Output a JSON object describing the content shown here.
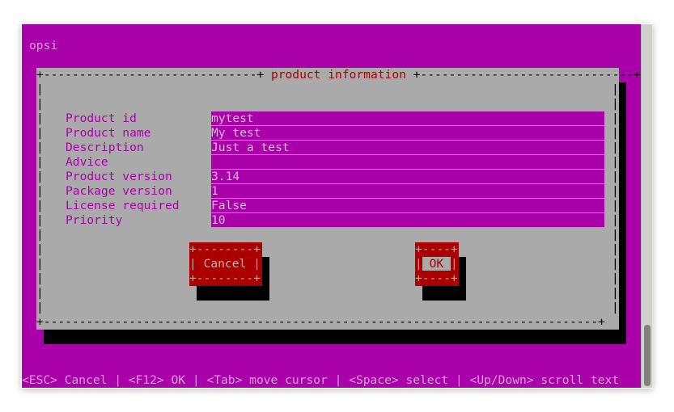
{
  "app": {
    "title": "opsi"
  },
  "dialog": {
    "title": "product information",
    "fields": [
      {
        "label": "Product id",
        "value": "mytest"
      },
      {
        "label": "Product name",
        "value": "My test"
      },
      {
        "label": "Description",
        "value": "Just a test"
      },
      {
        "label": "Advice",
        "value": ""
      },
      {
        "label": "Product version",
        "value": "3.14"
      },
      {
        "label": "Package version",
        "value": "1"
      },
      {
        "label": "License required",
        "value": "False"
      },
      {
        "label": "Priority",
        "value": "10"
      }
    ],
    "buttons": {
      "cancel": {
        "label": "Cancel"
      },
      "ok": {
        "label": "OK",
        "focused": true
      }
    }
  },
  "statusbar": {
    "text": "<ESC> Cancel | <F12> OK | <Tab> move cursor | <Space> select | <Up/Down> scroll text"
  },
  "colors": {
    "terminal_bg": "#aa00aa",
    "dialog_bg": "#aaaaaa",
    "button_bg": "#aa0000",
    "title_fg": "#aa0000",
    "shadow": "#000000"
  }
}
